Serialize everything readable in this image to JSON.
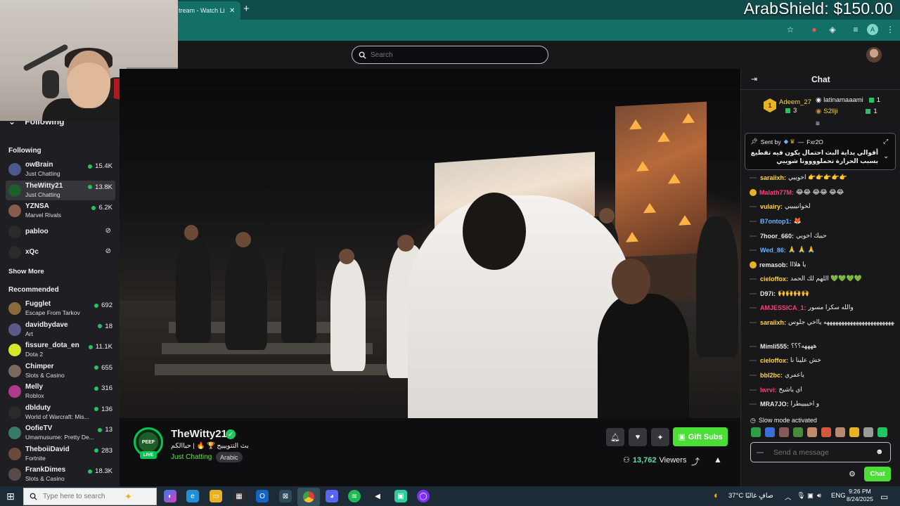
{
  "browser": {
    "tab_title": "tream - Watch Liv",
    "tab_close": "✕",
    "new_tab": "+",
    "overlay_money": "ArabShield: $150.00"
  },
  "topnav": {
    "search_placeholder": "Search"
  },
  "sidebar": {
    "header": "Following",
    "following_title": "Following",
    "following": [
      {
        "name": "owBrain",
        "game": "Just Chatting",
        "viewers": "15.4K",
        "color": "#4a5a8a"
      },
      {
        "name": "TheWitty21",
        "game": "Just Chatting",
        "viewers": "13.8K",
        "color": "#1d5e2a"
      },
      {
        "name": "YZNSA",
        "game": "Marvel Rivals",
        "viewers": "6.2K",
        "color": "#8a5a4a"
      },
      {
        "name": "pabloo",
        "game": "",
        "viewers": "",
        "color": "#2b2b2b"
      },
      {
        "name": "xQc",
        "game": "",
        "viewers": "",
        "color": "#2b2b2b"
      }
    ],
    "show_more": "Show More",
    "recommended_title": "Recommended",
    "recommended": [
      {
        "name": "Fugglet",
        "game": "Escape From Tarkov",
        "viewers": "692",
        "color": "#8a6a3a"
      },
      {
        "name": "davidbydave",
        "game": "Art",
        "viewers": "18",
        "color": "#5a5a8a"
      },
      {
        "name": "fissure_dota_en",
        "game": "Dota 2",
        "viewers": "11.1K",
        "color": "#d7e82a"
      },
      {
        "name": "Chimper",
        "game": "Slots & Casino",
        "viewers": "655",
        "color": "#7a6a5a"
      },
      {
        "name": "Melly",
        "game": "Roblox",
        "viewers": "316",
        "color": "#b03a8a"
      },
      {
        "name": "dblduty",
        "game": "World of Warcraft: Mis...",
        "viewers": "136",
        "color": "#2a2a2a"
      },
      {
        "name": "OofieTV",
        "game": "Umamusume: Pretty De...",
        "viewers": "13",
        "color": "#3a7a6a"
      },
      {
        "name": "TheboiiDavid",
        "game": "Fortnite",
        "viewers": "283",
        "color": "#6a4a3a"
      },
      {
        "name": "FrankDimes",
        "game": "Slots & Casino",
        "viewers": "18.3K",
        "color": "#5a4a4a"
      }
    ]
  },
  "stream": {
    "avatar_text": "PEEF",
    "live_label": "LIVE",
    "channel": "TheWitty21",
    "title": "بث التتويييج 🏆 🔥 | حياالكم",
    "category": "Just Chatting",
    "tag": "Arabic",
    "gift_label": "Gift Subs",
    "viewers": "13,762",
    "viewers_label": "Viewers"
  },
  "chat": {
    "title": "Chat",
    "leaders": [
      {
        "name": "Adeem_27",
        "count": "3",
        "rank": "1"
      },
      {
        "name": "latinamaaami",
        "count": "1"
      },
      {
        "name": "S2llji",
        "count": "1"
      }
    ],
    "pinned": {
      "sent_by": "Sent by",
      "author": "Fxr2O",
      "text": "أقوالي بداية البث احتمال يكون فيه تقطيع بسبب الحرارة تحملوووونا شوييي"
    },
    "messages": [
      {
        "user": "saraiixh",
        "text": "اخوييي 👉👉👉👉👉",
        "color": "#ffd54a",
        "badge": false
      },
      {
        "user": "Malath77M",
        "text": "😂😂 😂😂 😂😂",
        "color": "#ff3d7f",
        "badge": true
      },
      {
        "user": "vulairy",
        "text": "لخوانييييي",
        "color": "#ffd54a",
        "badge": false
      },
      {
        "user": "B7ontop1",
        "text": "🦊",
        "color": "#6fb3ff",
        "badge": false
      },
      {
        "user": "7hoor_660",
        "text": "حييك اخويي",
        "color": "#e8e8e8",
        "badge": false
      },
      {
        "user": "Wed_86",
        "text": "🙏 🙏 🙏",
        "color": "#6fb3ff",
        "badge": false
      },
      {
        "user": "remasob",
        "text": "يا هلااا",
        "color": "#e8e8e8",
        "badge": true
      },
      {
        "user": "cieloffox",
        "text": "اللهم لك الحمد 💚💚💚💚",
        "color": "#ffd54a",
        "badge": false
      },
      {
        "user": "D97i",
        "text": "🙌🙌🙌🙌",
        "color": "#e8e8e8",
        "badge": false
      },
      {
        "user": "AMJESSICA_1",
        "text": "والله سكرا مسور",
        "color": "#ff3d7f",
        "badge": false
      },
      {
        "user": "saraiixh",
        "text": "ههههههههههههههههههههههههه يااخي جلوس",
        "color": "#ffd54a",
        "badge": false
      },
      {
        "user": "Mimli555",
        "text": "ههههه؟؟؟",
        "color": "#e8e8e8",
        "badge": false
      },
      {
        "user": "cieloffox",
        "text": "خش علينا نا",
        "color": "#ffd54a",
        "badge": false
      },
      {
        "user": "bbl2bc",
        "text": "ياعمري",
        "color": "#ffd54a",
        "badge": false
      },
      {
        "user": "lwrvi",
        "text": "اي ياشيخ",
        "color": "#ff3d7f",
        "badge": false
      },
      {
        "user": "MRA7JO",
        "text": "و اخييييطرا",
        "color": "#e8e8e8",
        "badge": false
      }
    ],
    "slow_mode": "Slow mode activated",
    "input_placeholder": "Send a message",
    "chat_button": "Chat"
  },
  "taskbar": {
    "search_placeholder": "Type here to search",
    "weather": "37°C صافٍ غالبًا",
    "lang": "ENG",
    "time": "9:26 PM",
    "date": "8/24/2025"
  }
}
